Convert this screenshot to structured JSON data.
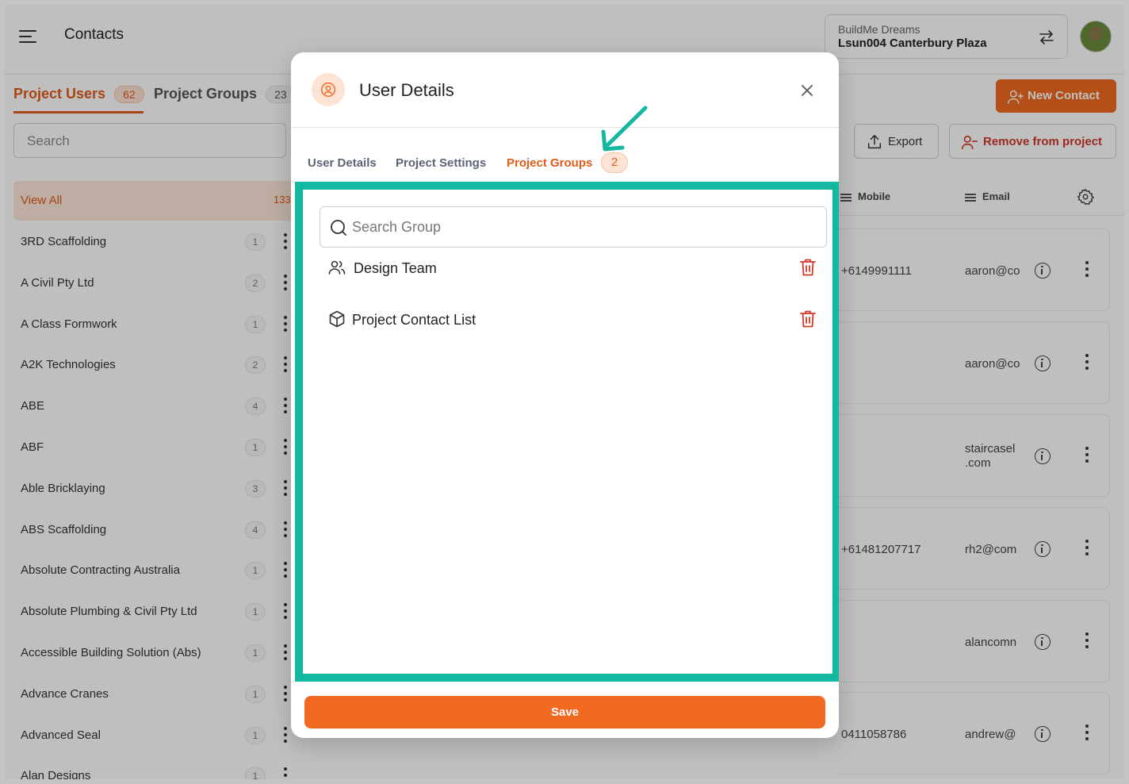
{
  "app": {
    "title": "Contacts",
    "org_name": "BuildMe Dreams",
    "project_name": "Lsun004 Canterbury Plaza"
  },
  "left_tabs": [
    {
      "label": "Project Users",
      "count": "62"
    },
    {
      "label": "Project Groups",
      "count": "23"
    }
  ],
  "left_search": {
    "placeholder": "Search"
  },
  "view_all": {
    "label": "View All",
    "count": "133"
  },
  "companies": [
    {
      "name": "3RD Scaffolding",
      "count": "1"
    },
    {
      "name": "A Civil Pty Ltd",
      "count": "2"
    },
    {
      "name": "A Class Formwork",
      "count": "1"
    },
    {
      "name": "A2K Technologies",
      "count": "2"
    },
    {
      "name": "ABE",
      "count": "4"
    },
    {
      "name": "ABF",
      "count": "1"
    },
    {
      "name": "Able Bricklaying",
      "count": "3"
    },
    {
      "name": "ABS Scaffolding",
      "count": "4"
    },
    {
      "name": "Absolute Contracting Australia",
      "count": "1"
    },
    {
      "name": "Absolute Plumbing & Civil Pty Ltd",
      "count": "1"
    },
    {
      "name": "Accessible Building Solution (Abs)",
      "count": "1"
    },
    {
      "name": "Advance Cranes",
      "count": "1"
    },
    {
      "name": "Advanced Seal",
      "count": "1"
    },
    {
      "name": "Alan Designs",
      "count": "1"
    }
  ],
  "actions": {
    "new_contact": "New Contact",
    "export": "Export",
    "remove_from_project": "Remove from project"
  },
  "table": {
    "columns": [
      "Mobile",
      "Email"
    ],
    "rows": [
      {
        "mobile": "+6149991111",
        "email": "aaron@co"
      },
      {
        "mobile": "",
        "email": "aaron@co"
      },
      {
        "mobile": "",
        "email": "staircasel .com"
      },
      {
        "mobile": "+61481207717",
        "email": "rh2@com"
      },
      {
        "mobile": "",
        "email": "alancomn"
      },
      {
        "mobile": "0411058786",
        "email": "andrew@"
      }
    ]
  },
  "modal": {
    "title": "User Details",
    "tabs": [
      "User Details",
      "Project Settings",
      "Project Groups"
    ],
    "active_tab": "Project Groups",
    "groups_count": "2",
    "search_placeholder": "Search Group",
    "groups": [
      {
        "name": "Design Team",
        "icon": "users-icon"
      },
      {
        "name": "Project Contact List",
        "icon": "box-icon"
      }
    ],
    "save_label": "Save"
  },
  "colors": {
    "accent": "#f26a21",
    "highlight": "#14b8a0",
    "danger": "#d0382a"
  }
}
